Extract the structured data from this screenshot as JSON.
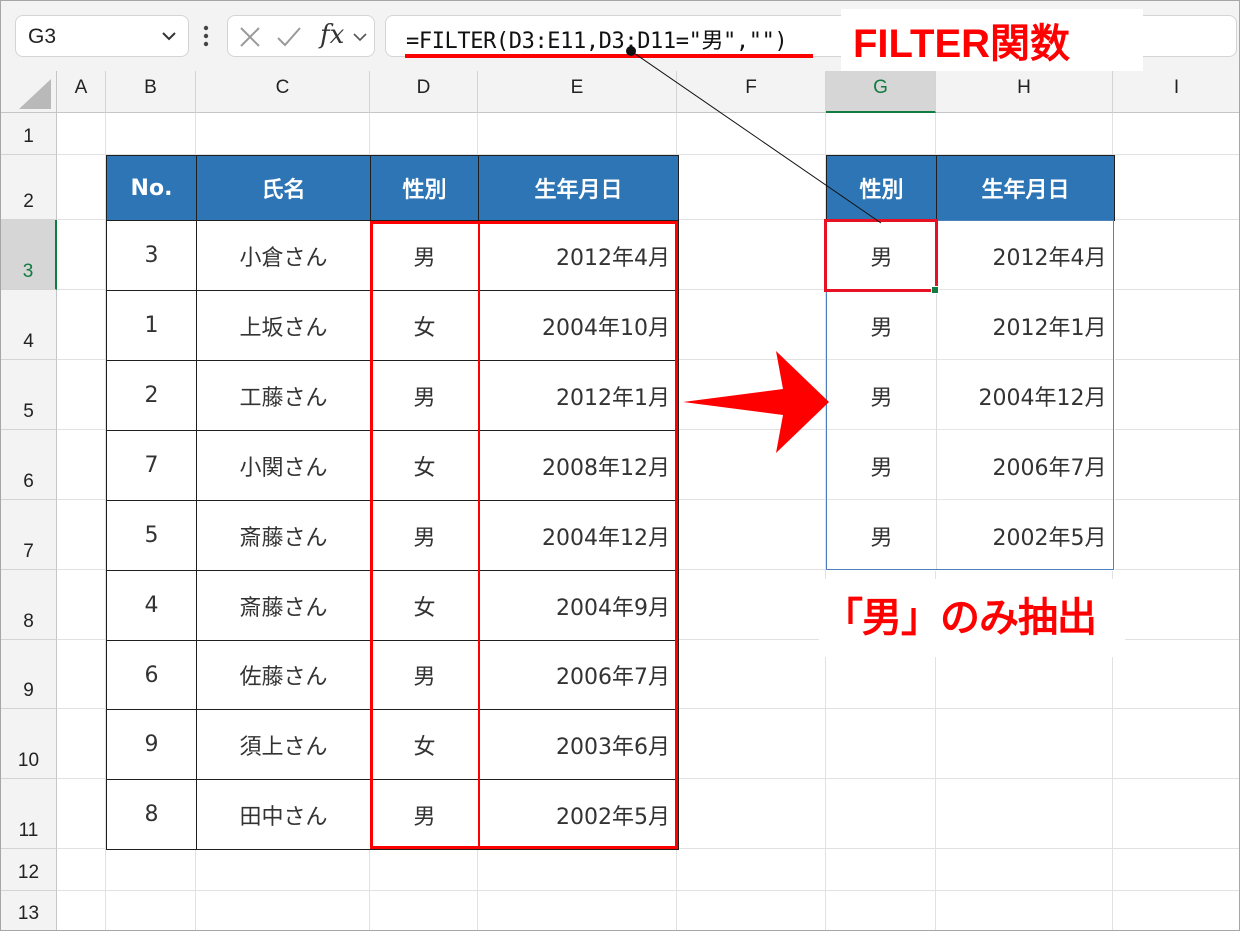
{
  "formula_bar": {
    "name_box": "G3",
    "fx_label": "fx",
    "formula": "=FILTER(D3:E11,D3:D11=\"男\",\"\")"
  },
  "callout": "FILTER関数",
  "note": "「男」のみ抽出",
  "columns": [
    "A",
    "B",
    "C",
    "D",
    "E",
    "F",
    "G",
    "H",
    "I"
  ],
  "selected_column": "G",
  "rows": [
    "1",
    "2",
    "3",
    "4",
    "5",
    "6",
    "7",
    "8",
    "9",
    "10",
    "11",
    "12",
    "13"
  ],
  "selected_row": "3",
  "source_table": {
    "headers": [
      "No.",
      "氏名",
      "性別",
      "生年月日"
    ],
    "rows": [
      [
        "3",
        "小倉さん",
        "男",
        "2012年4月"
      ],
      [
        "1",
        "上坂さん",
        "女",
        "2004年10月"
      ],
      [
        "2",
        "工藤さん",
        "男",
        "2012年1月"
      ],
      [
        "7",
        "小関さん",
        "女",
        "2008年12月"
      ],
      [
        "5",
        "斎藤さん",
        "男",
        "2004年12月"
      ],
      [
        "4",
        "斎藤さん",
        "女",
        "2004年9月"
      ],
      [
        "6",
        "佐藤さん",
        "男",
        "2006年7月"
      ],
      [
        "9",
        "須上さん",
        "女",
        "2003年6月"
      ],
      [
        "8",
        "田中さん",
        "男",
        "2002年5月"
      ]
    ]
  },
  "result_table": {
    "headers": [
      "性別",
      "生年月日"
    ],
    "rows": [
      [
        "男",
        "2012年4月"
      ],
      [
        "男",
        "2012年1月"
      ],
      [
        "男",
        "2004年12月"
      ],
      [
        "男",
        "2006年7月"
      ],
      [
        "男",
        "2002年5月"
      ]
    ]
  },
  "colors": {
    "header_fill": "#2e75b6",
    "highlight_red": "#ff0000",
    "excel_green": "#107c41"
  }
}
